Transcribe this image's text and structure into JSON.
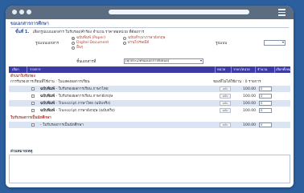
{
  "page": {
    "title": "ขอเอกสารการศึกษา",
    "step_label": "ขั้นที่ 1.",
    "step_desc": "เลือกรูปแบบเอกสาร ใบรับรอง/คำร้อง จำนวน ราคาต่อหน่วย ที่ต้องการ",
    "format_label": "รูปแบบเอกสาร",
    "format_options": [
      "ฉบับพิมพ์ (Paper)",
      "ฉบับสำเนาภาษาอังกฤษ",
      "Digital Document",
      "ผ่านไปรษณีย์",
      "อื่นๆ"
    ],
    "type_label": "รูปแบบ",
    "subtype_label": "ชั้นเอกสารที่",
    "subtype_select": "[ทุกประเภทของเอกสารทั้งหมด]"
  },
  "table": {
    "headers": [
      "เลือก",
      "รายการ",
      "หน่วย",
      "ราคา/หน่วย",
      "จำนวน",
      "เลือกทั้งหมด"
    ]
  },
  "sections": [
    {
      "title": "สำเนาใบรับรอง",
      "subtitle": "การรับรองการเรียนที่ใช้งาน : ใบแสดงผลการเรียน",
      "right": "ของที่ไม่ได้ใช้งาน : 0 รายการ",
      "rows": [
        {
          "prefix": "ฉบับพิมพ์",
          "label": "ใบรับรองผลการเรียน ภาษาไทย",
          "unit": "ฉบับ",
          "price": "100.00",
          "qty": "0"
        },
        {
          "prefix": "ฉบับพิมพ์",
          "label": "ใบรับรองผลการเรียน ภาษาอังกฤษ",
          "unit": "ฉบับ",
          "price": "100.00",
          "qty": "0"
        },
        {
          "prefix": "ฉบับพิมพ์",
          "label": "Transcript ภาษาไทย (ฉบับจริง)",
          "unit": "ฉบับ",
          "price": "100.00",
          "qty": "0"
        },
        {
          "prefix": "ฉบับพิมพ์",
          "label": "Transcript ภาษาอังกฤษ (ฉบับจริง)",
          "unit": "ฉบับ",
          "price": "100.00",
          "qty": "0"
        }
      ]
    },
    {
      "title": "ใบรับรองการเป็นนักศึกษา",
      "rows": [
        {
          "prefix": "",
          "label": "ใบรับรองการเป็นนักศึกษา",
          "unit": "ฉบับ",
          "price": "100.00",
          "qty": "0"
        }
      ]
    }
  ],
  "notes_label": "ส่วนหมายเหตุ",
  "colors": {
    "header_bg": "#3c3aa5",
    "row_blue": "#dbe4f3",
    "title": "#4464a8",
    "accent_red": "#b2362a"
  }
}
